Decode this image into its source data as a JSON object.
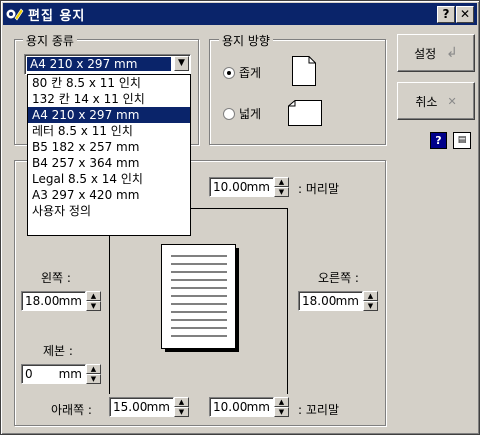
{
  "window": {
    "title": "편집 용지",
    "help_btn": "?",
    "close_btn": "✕"
  },
  "paper_type": {
    "label": "용지 종류",
    "selected": "A4  210 x 297 mm",
    "options": [
      "80 칸  8.5 x 11 인치",
      "132 칸  14 x 11 인치",
      "A4  210 x 297 mm",
      "레터  8.5 x 11 인치",
      "B5  182 x 257 mm",
      "B4  257 x 364 mm",
      "Legal  8.5 x 14 인치",
      "A3  297 x 420 mm",
      "사용자 정의"
    ],
    "selected_index": 2
  },
  "orientation": {
    "label": "용지 방향",
    "portrait_label": "좁게",
    "landscape_label": "넓게",
    "selected": "portrait"
  },
  "buttons": {
    "ok": "설정",
    "cancel": "취소"
  },
  "margins": {
    "unit": "mm",
    "header": {
      "label": ": 머리말",
      "value": "10.00"
    },
    "left": {
      "label": "왼쪽 :",
      "value": "18.00"
    },
    "right": {
      "label": "오른쪽 :",
      "value": "18.00"
    },
    "binding": {
      "label": "제본 :",
      "value": "0"
    },
    "bottom": {
      "label": "아래쪽 :",
      "value": "15.00"
    },
    "footer": {
      "label": ": 꼬리말",
      "value": "10.00"
    }
  }
}
